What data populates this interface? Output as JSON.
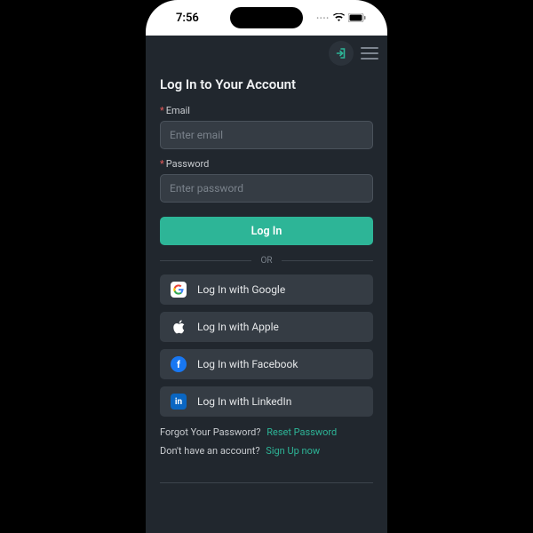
{
  "statusbar": {
    "time": "7:56"
  },
  "page": {
    "title": "Log In to Your Account",
    "email": {
      "label": "Email",
      "placeholder": "Enter email"
    },
    "password": {
      "label": "Password",
      "placeholder": "Enter password"
    },
    "login_btn": "Log In",
    "or": "OR",
    "social": {
      "google": "Log In with Google",
      "apple": "Log In with Apple",
      "facebook": "Log In with Facebook",
      "linkedin": "Log In with LinkedIn"
    },
    "forgot": {
      "q": "Forgot Your Password?",
      "link": "Reset Password"
    },
    "signup": {
      "q": "Don't have an account?",
      "link": "Sign Up now"
    }
  }
}
